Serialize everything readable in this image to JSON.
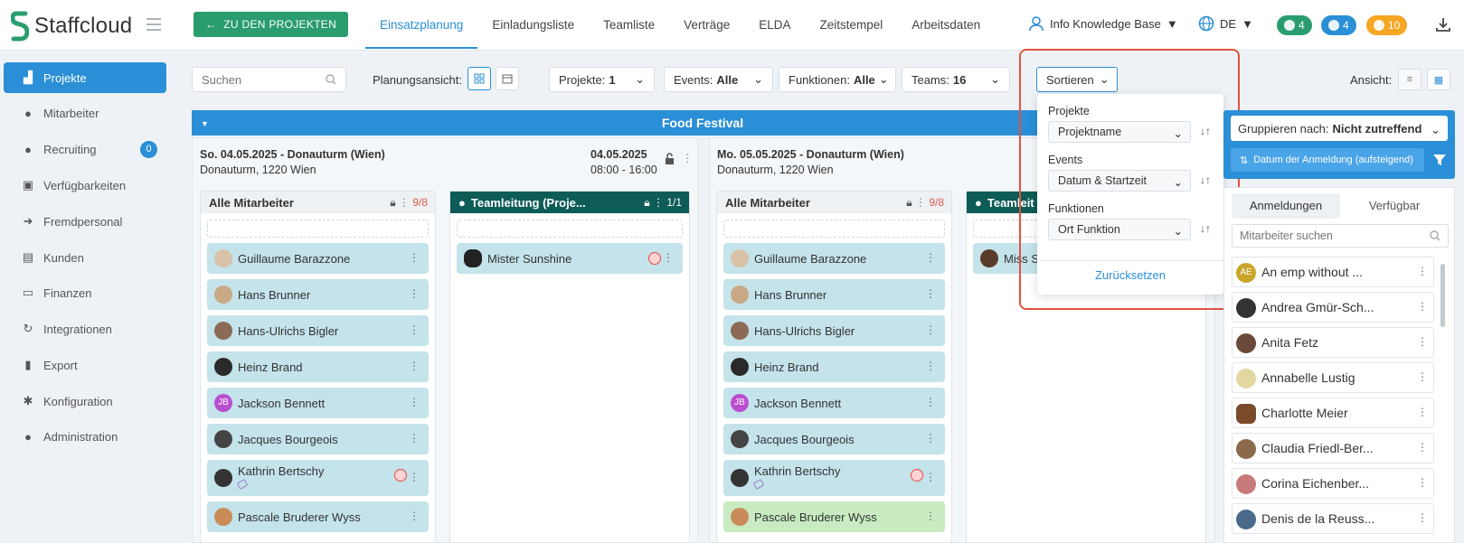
{
  "app": {
    "name": "Staffcloud"
  },
  "header": {
    "back_label": "ZU DEN PROJEKTEN",
    "tabs": [
      "Einsatzplanung",
      "Einladungsliste",
      "Teamliste",
      "Verträge",
      "ELDA",
      "Zeitstempel",
      "Arbeitsdaten"
    ],
    "active_tab": "Einsatzplanung",
    "user": "Info Knowledge Base",
    "language": "DE",
    "badges": [
      {
        "icon": "chat-icon",
        "value": "4",
        "color": "#2a9d6f"
      },
      {
        "icon": "bell-icon",
        "value": "4",
        "color": "#2a8fd6"
      },
      {
        "icon": "clock-icon",
        "value": "10",
        "color": "#f5a623"
      }
    ]
  },
  "sidebar": {
    "items": [
      {
        "label": "Projekte",
        "icon": "projects-icon",
        "active": true
      },
      {
        "label": "Mitarbeiter",
        "icon": "employees-icon"
      },
      {
        "label": "Recruiting",
        "icon": "recruiting-icon",
        "count": "0"
      },
      {
        "label": "Verfügbarkeiten",
        "icon": "calendar-check-icon"
      },
      {
        "label": "Fremdpersonal",
        "icon": "sign-in-icon"
      },
      {
        "label": "Kunden",
        "icon": "building-icon"
      },
      {
        "label": "Finanzen",
        "icon": "money-icon"
      },
      {
        "label": "Integrationen",
        "icon": "sync-icon"
      },
      {
        "label": "Export",
        "icon": "file-icon"
      },
      {
        "label": "Konfiguration",
        "icon": "gear-icon"
      },
      {
        "label": "Administration",
        "icon": "user-cog-icon"
      }
    ]
  },
  "toolbar": {
    "search_placeholder": "Suchen",
    "plan_label": "Planungsansicht:",
    "filters": [
      {
        "label": "Projekte:",
        "value": "1"
      },
      {
        "label": "Events:",
        "value": "Alle"
      },
      {
        "label": "Funktionen:",
        "value": "Alle"
      },
      {
        "label": "Teams:",
        "value": "16"
      }
    ],
    "sort_label": "Sortieren",
    "ansicht_label": "Ansicht:"
  },
  "sort_dropdown": {
    "sections": [
      {
        "label": "Projekte",
        "value": "Projektname"
      },
      {
        "label": "Events",
        "value": "Datum & Startzeit"
      },
      {
        "label": "Funktionen",
        "value": "Ort Funktion"
      }
    ],
    "reset_label": "Zurücksetzen"
  },
  "event": {
    "title": "Food Festival",
    "days": [
      {
        "title": "So. 04.05.2025 - Donauturm (Wien)",
        "address": "Donauturm, 1220 Wien",
        "date": "04.05.2025",
        "time": "08:00 - 16:00"
      },
      {
        "title": "Mo. 05.05.2025 - Donauturm (Wien)",
        "address": "Donauturm, 1220 Wien"
      }
    ]
  },
  "columns": [
    {
      "title": "Alle Mitarbeiter",
      "count": "9/8",
      "style": "gray",
      "employees": [
        {
          "name": "Guillaume Barazzone"
        },
        {
          "name": "Hans Brunner"
        },
        {
          "name": "Hans-Ulrichs Bigler"
        },
        {
          "name": "Heinz Brand"
        },
        {
          "name": "Jackson Bennett",
          "initials": "JB"
        },
        {
          "name": "Jacques Bourgeois"
        },
        {
          "name": "Kathrin Bertschy",
          "stop": true,
          "tag": true
        },
        {
          "name": "Pascale Bruderer Wyss"
        }
      ]
    },
    {
      "title": "Teamleitung (Proje...",
      "count": "1/1",
      "style": "dark",
      "employees": [
        {
          "name": "Mister Sunshine",
          "stop": true
        }
      ]
    },
    {
      "title": "Alle Mitarbeiter",
      "count": "9/8",
      "style": "gray",
      "employees": [
        {
          "name": "Guillaume Barazzone"
        },
        {
          "name": "Hans Brunner"
        },
        {
          "name": "Hans-Ulrichs Bigler"
        },
        {
          "name": "Heinz Brand"
        },
        {
          "name": "Jackson Bennett",
          "initials": "JB"
        },
        {
          "name": "Jacques Bourgeois"
        },
        {
          "name": "Kathrin Bertschy",
          "stop": true,
          "tag": true
        },
        {
          "name": "Pascale Bruderer Wyss",
          "green": true
        }
      ]
    },
    {
      "title": "Teamleit",
      "style": "dark",
      "employees": [
        {
          "name": "Miss S"
        }
      ]
    }
  ],
  "right_panel": {
    "group_label": "Gruppieren nach:",
    "group_value": "Nicht zutreffend",
    "date_sort": "Datum der Anmeldung (aufsteigend)",
    "tabs": [
      "Anmeldungen",
      "Verfügbar"
    ],
    "search_placeholder": "Mitarbeiter suchen",
    "people": [
      {
        "name": "An emp without ...",
        "initials": "AE"
      },
      {
        "name": "Andrea Gmür-Sch..."
      },
      {
        "name": "Anita Fetz"
      },
      {
        "name": "Annabelle Lustig"
      },
      {
        "name": "Charlotte Meier"
      },
      {
        "name": "Claudia Friedl-Ber..."
      },
      {
        "name": "Corina Eichenber..."
      },
      {
        "name": "Denis de la Reuss..."
      }
    ]
  }
}
